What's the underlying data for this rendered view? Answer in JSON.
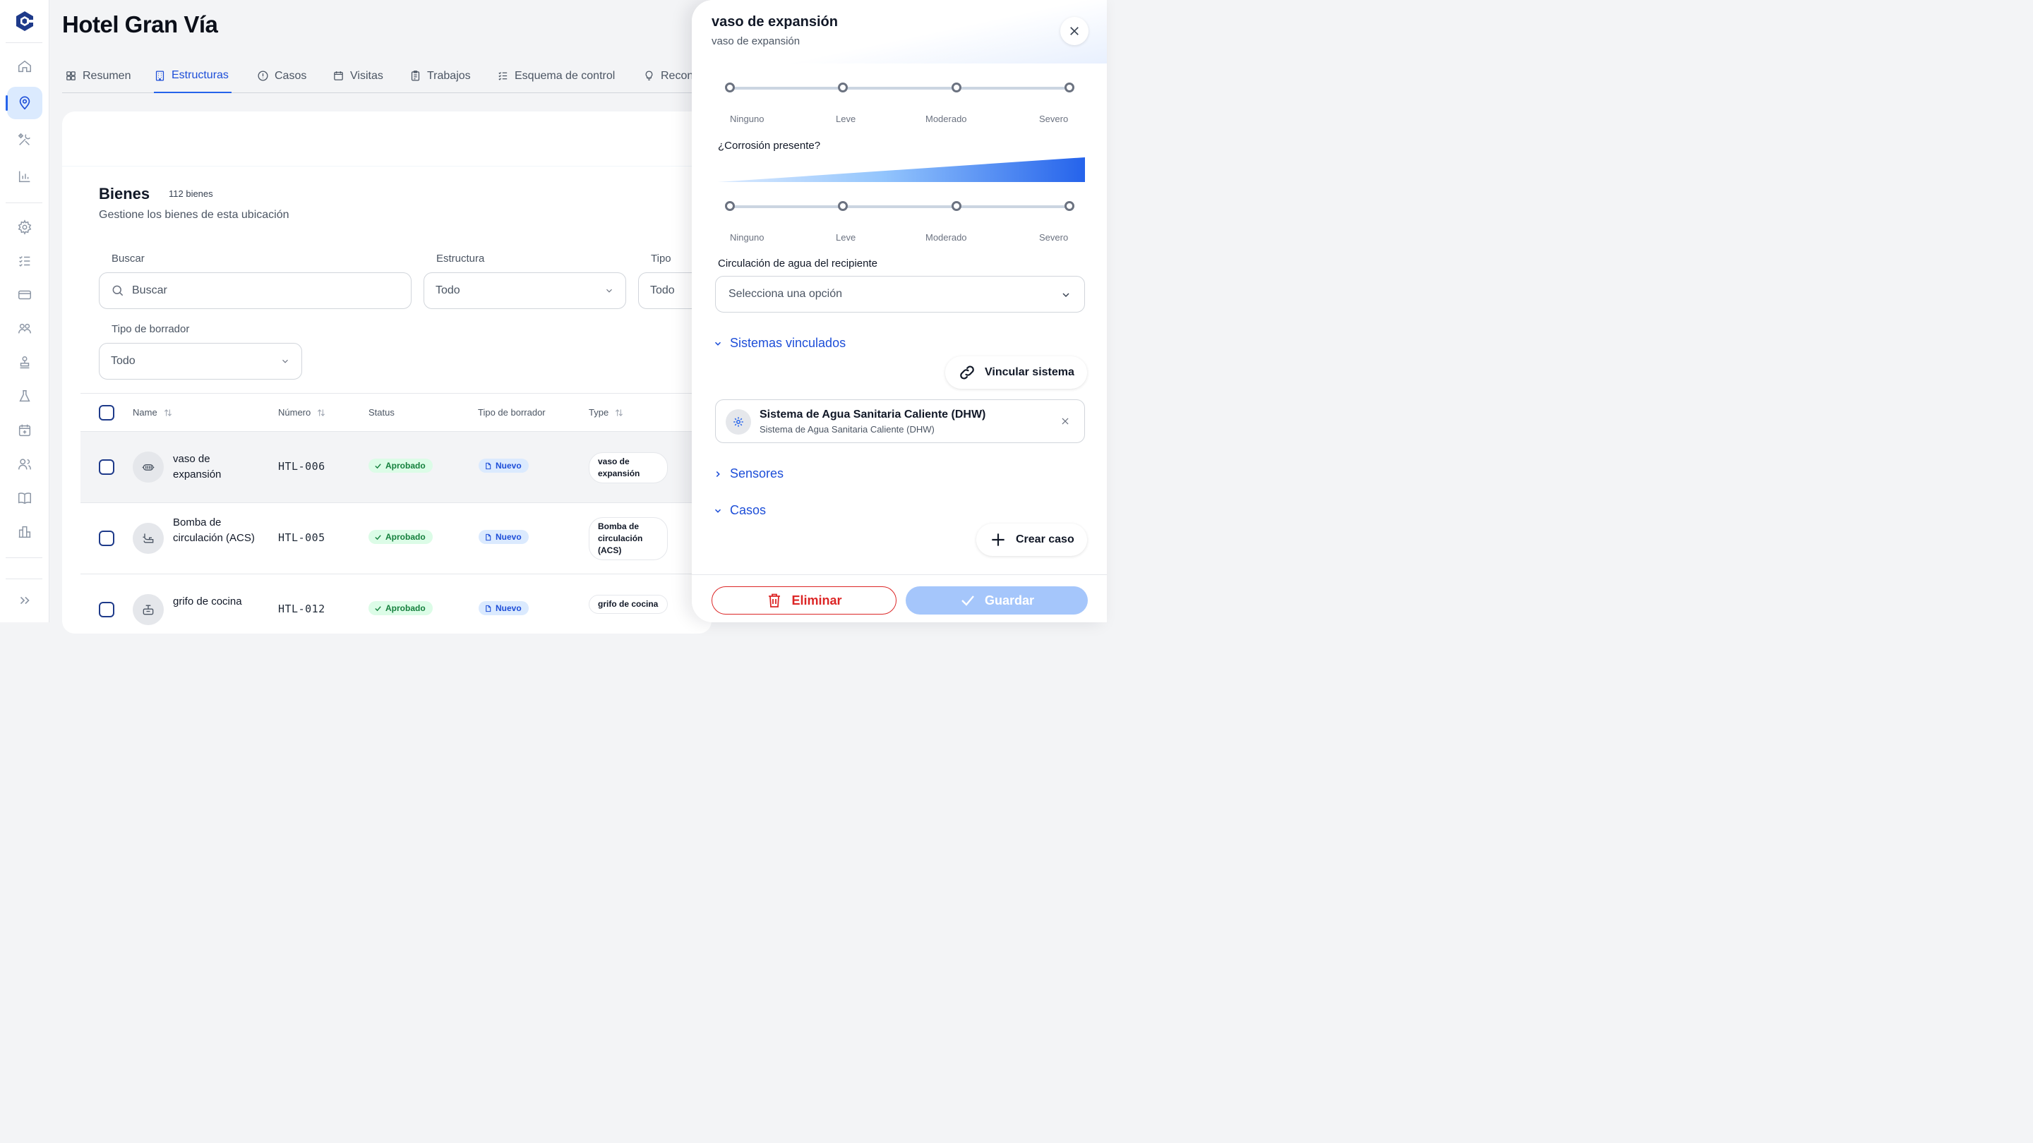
{
  "header": {
    "title": "Hotel Gran Vía"
  },
  "tabs": [
    {
      "label": "Resumen",
      "icon": "grid-icon"
    },
    {
      "label": "Estructuras",
      "icon": "building-icon",
      "active": true
    },
    {
      "label": "Casos",
      "icon": "alert-circle-icon"
    },
    {
      "label": "Visitas",
      "icon": "calendar-icon"
    },
    {
      "label": "Trabajos",
      "icon": "clipboard-icon"
    },
    {
      "label": "Esquema de control",
      "icon": "checklist-icon"
    },
    {
      "label": "Recon",
      "icon": "lightbulb-icon"
    }
  ],
  "section": {
    "title": "Bienes",
    "count": "112 bienes",
    "subtitle": "Gestione los bienes de esta ubicación"
  },
  "filters": {
    "search_label": "Buscar",
    "search_placeholder": "Buscar",
    "estructura_label": "Estructura",
    "estructura_value": "Todo",
    "tipo_label": "Tipo",
    "tipo_value": "Todo",
    "borrador_label": "Tipo de borrador",
    "borrador_value": "Todo"
  },
  "table": {
    "columns": [
      "Name",
      "Número",
      "Status",
      "Tipo de borrador",
      "Type"
    ],
    "rows": [
      {
        "name": "vaso de expansión",
        "number": "HTL-006",
        "status": "Aprobado",
        "draft": "Nuevo",
        "type": "vaso de expansión"
      },
      {
        "name": "Bomba de circulación (ACS)",
        "number": "HTL-005",
        "status": "Aprobado",
        "draft": "Nuevo",
        "type": "Bomba de circulación (ACS)"
      },
      {
        "name": "grifo de cocina",
        "number": "HTL-012",
        "status": "Aprobado",
        "draft": "Nuevo",
        "type": "grifo de cocina"
      }
    ]
  },
  "drawer": {
    "title": "vaso de expansión",
    "subtitle": "vaso de expansión",
    "scale_labels": [
      "Ninguno",
      "Leve",
      "Moderado",
      "Severo"
    ],
    "corrosion_question": "¿Corrosión presente?",
    "circulation_label": "Circulación de agua del recipiente",
    "circulation_placeholder": "Selecciona una opción",
    "linked_systems_title": "Sistemas vinculados",
    "link_system_button": "Vincular sistema",
    "system": {
      "name": "Sistema de Agua Sanitaria Caliente (DHW)",
      "subtitle": "Sistema de Agua Sanitaria Caliente (DHW)"
    },
    "sensors_title": "Sensores",
    "cases_title": "Casos",
    "create_case_button": "Crear caso",
    "delete_button": "Eliminar",
    "save_button": "Guardar"
  },
  "colors": {
    "accent": "#2563eb",
    "danger": "#dc2626",
    "success": "#15803d"
  }
}
